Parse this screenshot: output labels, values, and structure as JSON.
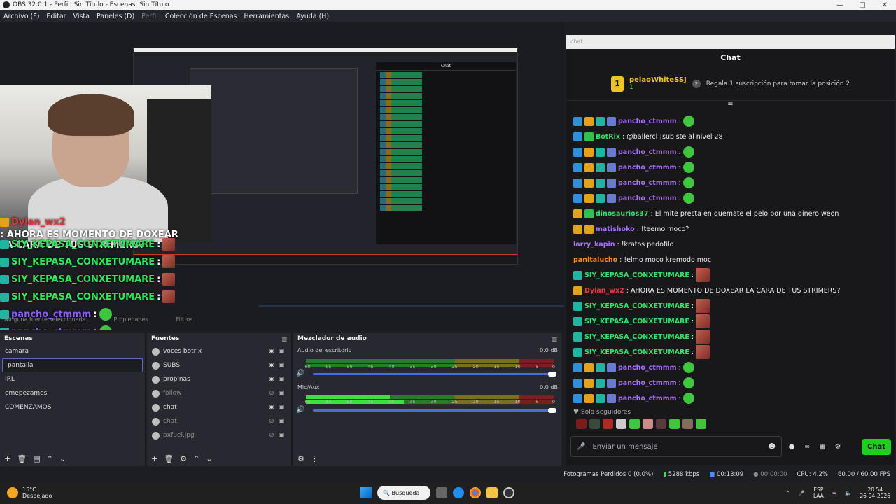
{
  "window": {
    "title": "OBS 32.0.1 - Perfil: Sin Título - Escenas: Sin Título"
  },
  "menu": [
    {
      "label": "Archivo (F)",
      "dim": false
    },
    {
      "label": "Editar",
      "dim": false
    },
    {
      "label": "Vista",
      "dim": false
    },
    {
      "label": "Paneles (D)",
      "dim": false
    },
    {
      "label": "Perfil",
      "dim": true
    },
    {
      "label": "Colección de Escenas",
      "dim": false
    },
    {
      "label": "Herramientas",
      "dim": false
    },
    {
      "label": "Ayuda (H)",
      "dim": false
    }
  ],
  "overlay": [
    {
      "user": "Dylan_wx2",
      "text": ": AHORA ES MOMENTO DE DOXEAR LA CARA DE TUS STRIMERS?",
      "color": "red"
    },
    {
      "user": "SIY_KEPASA_CONXETUMARE",
      "text": " :",
      "color": "green"
    },
    {
      "user": "SIY_KEPASA_CONXETUMARE",
      "text": " :",
      "color": "green"
    },
    {
      "user": "SIY_KEPASA_CONXETUMARE",
      "text": " :",
      "color": "green"
    },
    {
      "user": "SIY_KEPASA_CONXETUMARE",
      "text": " :",
      "color": "green"
    },
    {
      "user": "pancho_ctmmm",
      "text": " :",
      "color": "blue"
    },
    {
      "user": "pancho_ctmmm",
      "text": " :",
      "color": "blue"
    }
  ],
  "preview_labels": {
    "no_source": "Ninguna fuente seleccionada",
    "properties": "Propiedades",
    "filters": "Filtros"
  },
  "scenes": {
    "title": "Escenas",
    "items": [
      "camara",
      "pantalla",
      "IRL",
      "emepezamos",
      "COMENZAMOS"
    ],
    "selected_index": 1
  },
  "sources": {
    "title": "Fuentes",
    "items": [
      {
        "label": "voces botrix",
        "visible": true
      },
      {
        "label": "SUBS",
        "visible": true
      },
      {
        "label": "propinas",
        "visible": true
      },
      {
        "label": "follow",
        "visible": false
      },
      {
        "label": "chat",
        "visible": true
      },
      {
        "label": "chat",
        "visible": false
      },
      {
        "label": "pxfuel.jpg",
        "visible": false
      }
    ]
  },
  "mixer": {
    "title": "Mezclador de audio",
    "channels": [
      {
        "name": "Audio del escritorio",
        "db": "0.0 dB"
      },
      {
        "name": "Mic/Aux",
        "db": "0.0 dB"
      }
    ],
    "scale": [
      "-60",
      "-55",
      "-50",
      "-45",
      "-40",
      "-35",
      "-30",
      "-25",
      "-20",
      "-15",
      "-10",
      "-5",
      "0"
    ]
  },
  "chat": {
    "tab_label": "chat",
    "title": "Chat",
    "pinned": {
      "rank": "1",
      "user": "pelaoWhiteSSJ",
      "count": "1",
      "gift_rank": "2",
      "gift_text": "Regala 1 suscripción para tomar la posición 2"
    },
    "messages": [
      {
        "user": "pancho_ctmmm",
        "sep": ":",
        "text": "",
        "ucolor": "purple",
        "badges": [
          "blue",
          "gold",
          "teal",
          "sword"
        ],
        "emote": "green"
      },
      {
        "user": "BotRix",
        "sep": ":",
        "text": "@ballercl ¡subiste al nivel 28!",
        "ucolor": "green",
        "badges": [
          "blue",
          "green"
        ],
        "emote": ""
      },
      {
        "user": "pancho_ctmmm",
        "sep": ":",
        "text": "",
        "ucolor": "purple",
        "badges": [
          "blue",
          "gold",
          "teal",
          "sword"
        ],
        "emote": "green"
      },
      {
        "user": "pancho_ctmmm",
        "sep": ":",
        "text": "",
        "ucolor": "purple",
        "badges": [
          "blue",
          "gold",
          "teal",
          "sword"
        ],
        "emote": "green"
      },
      {
        "user": "pancho_ctmmm",
        "sep": ":",
        "text": "",
        "ucolor": "purple",
        "badges": [
          "blue",
          "gold",
          "teal",
          "sword"
        ],
        "emote": "green"
      },
      {
        "user": "pancho_ctmmm",
        "sep": ":",
        "text": "",
        "ucolor": "purple",
        "badges": [
          "blue",
          "gold",
          "teal",
          "sword"
        ],
        "emote": "green"
      },
      {
        "user": "dinosaurios37",
        "sep": ":",
        "text": "El mite presta en quemate el pelo por una dinero weon",
        "ucolor": "green",
        "badges": [
          "gold",
          "green"
        ],
        "emote": ""
      },
      {
        "user": "matishoko",
        "sep": ":",
        "text": "!teemo moco?",
        "ucolor": "purple",
        "badges": [
          "gold",
          "gold"
        ],
        "emote": ""
      },
      {
        "user": "larry_kapin",
        "sep": ":",
        "text": "!kratos pedofilo",
        "ucolor": "purple",
        "badges": [],
        "emote": ""
      },
      {
        "user": "panitalucho",
        "sep": ":",
        "text": "!elmo moco kremodo moc",
        "ucolor": "yellow",
        "badges": [],
        "emote": ""
      },
      {
        "user": "SIY_KEPASA_CONXETUMARE",
        "sep": ":",
        "text": "",
        "ucolor": "green",
        "badges": [
          "teal"
        ],
        "emote": "red"
      },
      {
        "user": "Dylan_wx2",
        "sep": ":",
        "text": "AHORA ES MOMENTO DE DOXEAR LA CARA DE TUS STRIMERS?",
        "ucolor": "red",
        "badges": [
          "gold"
        ],
        "emote": ""
      },
      {
        "user": "SIY_KEPASA_CONXETUMARE",
        "sep": ":",
        "text": "",
        "ucolor": "green",
        "badges": [
          "teal"
        ],
        "emote": "red"
      },
      {
        "user": "SIY_KEPASA_CONXETUMARE",
        "sep": ":",
        "text": "",
        "ucolor": "green",
        "badges": [
          "teal"
        ],
        "emote": "red"
      },
      {
        "user": "SIY_KEPASA_CONXETUMARE",
        "sep": ":",
        "text": "",
        "ucolor": "green",
        "badges": [
          "teal"
        ],
        "emote": "red"
      },
      {
        "user": "SIY_KEPASA_CONXETUMARE",
        "sep": ":",
        "text": "",
        "ucolor": "green",
        "badges": [
          "teal"
        ],
        "emote": "red"
      },
      {
        "user": "pancho_ctmmm",
        "sep": ":",
        "text": "",
        "ucolor": "purple",
        "badges": [
          "blue",
          "gold",
          "teal",
          "sword"
        ],
        "emote": "green"
      },
      {
        "user": "pancho_ctmmm",
        "sep": ":",
        "text": "",
        "ucolor": "purple",
        "badges": [
          "blue",
          "gold",
          "teal",
          "sword"
        ],
        "emote": "green"
      },
      {
        "user": "pancho_ctmmm",
        "sep": ":",
        "text": "",
        "ucolor": "purple",
        "badges": [
          "blue",
          "gold",
          "teal",
          "sword"
        ],
        "emote": "green"
      }
    ],
    "followers_only": "Solo seguidores",
    "input_placeholder": "Enviar un mensaje",
    "send_label": "Chat"
  },
  "status": {
    "dropped": "Fotogramas Perdidos 0 (0.0%)",
    "bitrate": "5288 kbps",
    "live_time": "00:13:09",
    "rec_time": "00:00:00",
    "cpu": "CPU: 4.2%",
    "fps": "60.00 / 60.00 FPS"
  },
  "taskbar": {
    "temp": "15°C",
    "weather": "Despejado",
    "search": "Búsqueda",
    "lang": "ESP",
    "lang2": "LAA",
    "time": "20:54",
    "date": "26-04-2026"
  }
}
